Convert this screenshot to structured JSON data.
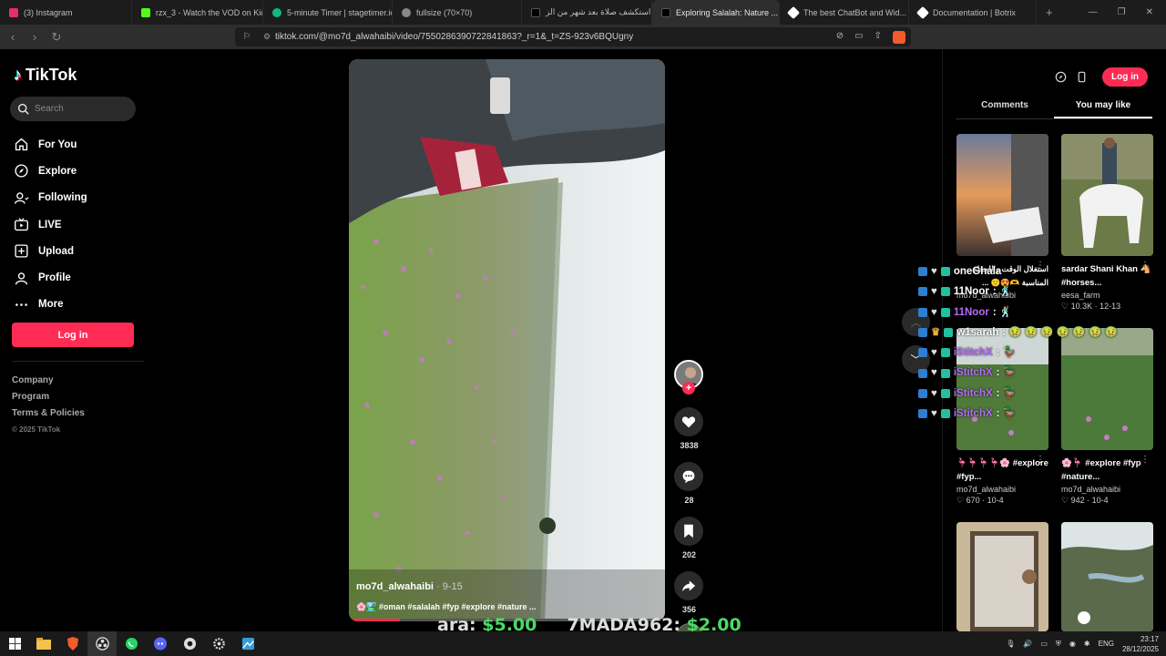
{
  "tabs": [
    {
      "label": "(3) Instagram",
      "color": "#e1306c"
    },
    {
      "label": "rzx_3 - Watch the VOD on Kick",
      "color": "#53fc18"
    },
    {
      "label": "5-minute Timer | stagetimer.io",
      "color": "#10b981"
    },
    {
      "label": "fullsize (70×70)",
      "color": "#888888"
    },
    {
      "label": "استكشف صلاة بعد شهر من الز...",
      "color": "#000000"
    },
    {
      "label": "Exploring Salalah: Nature ...",
      "color": "#000000"
    },
    {
      "label": "The best ChatBot and Wid...",
      "color": "#ffffff"
    },
    {
      "label": "Documentation | Botrix",
      "color": "#ffffff"
    }
  ],
  "address": {
    "url": "tiktok.com/@mo7d_alwahaibi/video/7550286390722841863?_r=1&_t=ZS-923v6BQUgny"
  },
  "sidebar": {
    "logo": "TikTok",
    "search_placeholder": "Search",
    "nav": [
      {
        "label": "For You",
        "icon": "home-icon"
      },
      {
        "label": "Explore",
        "icon": "compass-icon"
      },
      {
        "label": "Following",
        "icon": "following-icon"
      },
      {
        "label": "LIVE",
        "icon": "live-icon"
      },
      {
        "label": "Upload",
        "icon": "upload-icon"
      },
      {
        "label": "Profile",
        "icon": "profile-icon"
      },
      {
        "label": "More",
        "icon": "more-icon"
      }
    ],
    "login": "Log in",
    "footer": [
      "Company",
      "Program",
      "Terms & Policies"
    ],
    "copyright": "© 2025 TikTok"
  },
  "video": {
    "author": "mo7d_alwahaibi",
    "date": "· 9-15",
    "description": "🌸🏞️ #oman #salalah #fyp #explore #nature ...",
    "progress": 0.16
  },
  "actions": {
    "likes": "3838",
    "comments": "28",
    "saves": "202",
    "shares": "356"
  },
  "right": {
    "login": "Log in",
    "tabs": [
      "Comments",
      "You may like"
    ],
    "cards": [
      {
        "title": "استغلال الوقت واللحظه المناسبة 🫶😍🙂 ...",
        "user": "mo7d_alwahaibi",
        "likes": "670",
        "date": "10-4"
      },
      {
        "title": "sardar Shani Khan 🐴 #horses...",
        "user": "eesa_farm",
        "likes": "10.3K",
        "date": "12-13"
      },
      {
        "title": "🦩🦩🦩🦩🌸 #explore #fyp...",
        "user": "mo7d_alwahaibi",
        "likes": "670",
        "date": "10-4"
      },
      {
        "title": "🌸🦩 #explore #fyp #nature...",
        "user": "mo7d_alwahaibi",
        "likes": "942",
        "date": "10-4"
      }
    ]
  },
  "chat": [
    {
      "name": "oneGhala",
      "msg": "",
      "color": "white"
    },
    {
      "name": "11Noor",
      "msg": ": 🕺",
      "color": "white"
    },
    {
      "name": "11Noor",
      "msg": ": 🕺",
      "color": "purple"
    },
    {
      "name": "w1sarah",
      "msg": ": 🤢 🤢 🤢 🤢 🤢 🤢 🤢",
      "color": "white"
    },
    {
      "name": "iStitchX",
      "msg": ": 🦆",
      "color": "purple"
    },
    {
      "name": "iStitchX",
      "msg": ": 🦆",
      "color": "purple"
    },
    {
      "name": "iStitchX",
      "msg": ": 🦆",
      "color": "purple"
    },
    {
      "name": "iStitchX",
      "msg": ": 🦆",
      "color": "purple"
    }
  ],
  "donations": {
    "text1": "ara:",
    "amt1": "$5.00",
    "text2": "7MADA962:",
    "amt2": "$2.00"
  },
  "taskbar": {
    "lang": "ENG",
    "time": "23:17",
    "date": "28/12/2025"
  }
}
